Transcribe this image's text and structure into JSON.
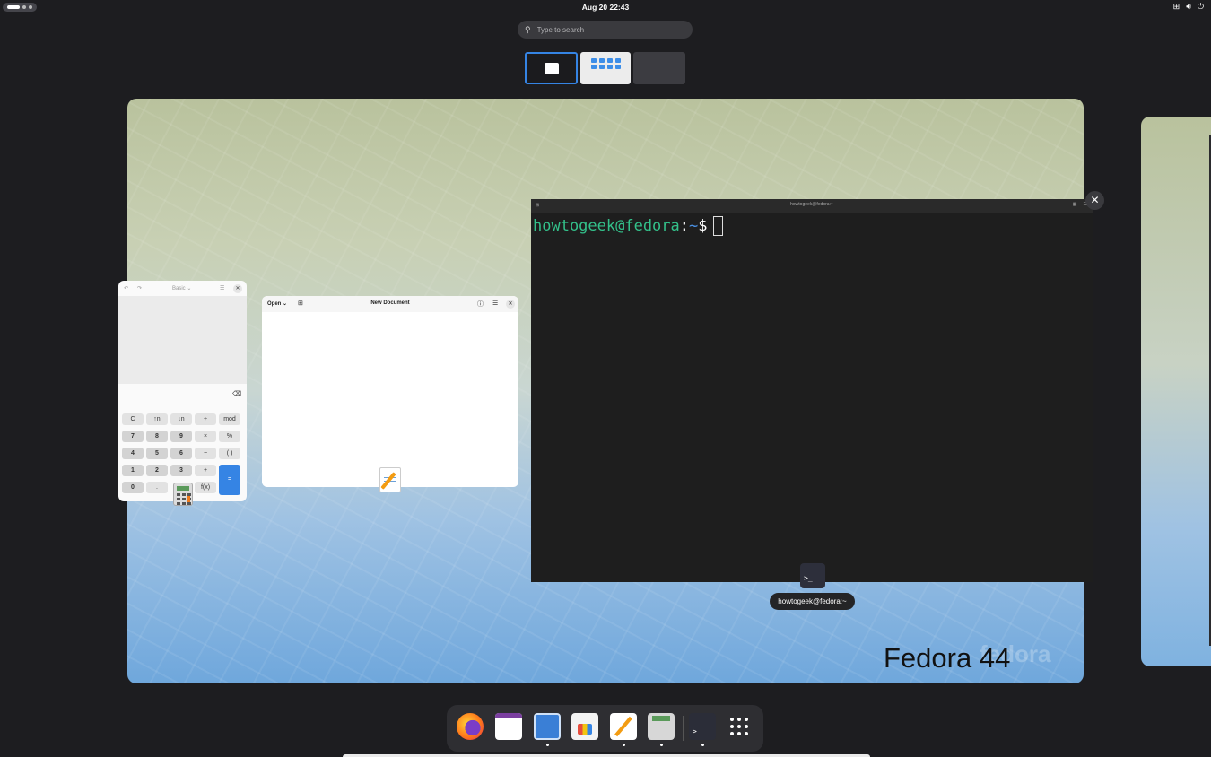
{
  "topbar": {
    "clock": "Aug 20  22:43",
    "icons": [
      "network-icon",
      "volume-icon",
      "power-icon"
    ]
  },
  "search": {
    "placeholder": "Type to search"
  },
  "workspace": {
    "wallpaper_label": "Fedora 44"
  },
  "calculator": {
    "mode": "Basic",
    "keys": [
      "C",
      "↑n",
      "↓n",
      "÷",
      "mod",
      "7",
      "8",
      "9",
      "×",
      "%",
      "4",
      "5",
      "6",
      "−",
      "( )",
      "1",
      "2",
      "3",
      "+",
      "=",
      "0",
      ".",
      "f(x)"
    ]
  },
  "text_editor": {
    "open_label": "Open",
    "title": "New Document"
  },
  "terminal": {
    "title": "howtogeek@fedora:~",
    "prompt_user": "howtogeek@fedora",
    "prompt_sep": ":",
    "prompt_path": "~",
    "prompt_dollar": "$",
    "tooltip": "howtogeek@fedora:~"
  },
  "dock": {
    "items": [
      "firefox-icon",
      "calendar-icon",
      "files-icon",
      "software-icon",
      "text-editor-icon",
      "calculator-icon",
      "terminal-icon",
      "app-grid-icon"
    ],
    "terminal_glyph": ">_"
  },
  "colors": {
    "accent": "#3584e4",
    "terminal_user": "#33c08a",
    "terminal_path": "#4a90e2"
  }
}
